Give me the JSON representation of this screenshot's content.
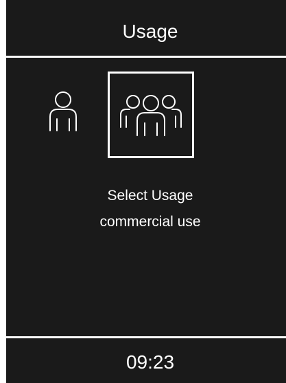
{
  "header": {
    "title": "Usage"
  },
  "usage_options": [
    {
      "icon": "single-person-icon",
      "selected": false
    },
    {
      "icon": "group-of-people-icon",
      "selected": true
    }
  ],
  "prompt": {
    "line1": "Select Usage",
    "line2": "commercial use"
  },
  "footer": {
    "time": "09:23"
  },
  "colors": {
    "background": "#1a1a1a",
    "foreground": "#ffffff"
  }
}
